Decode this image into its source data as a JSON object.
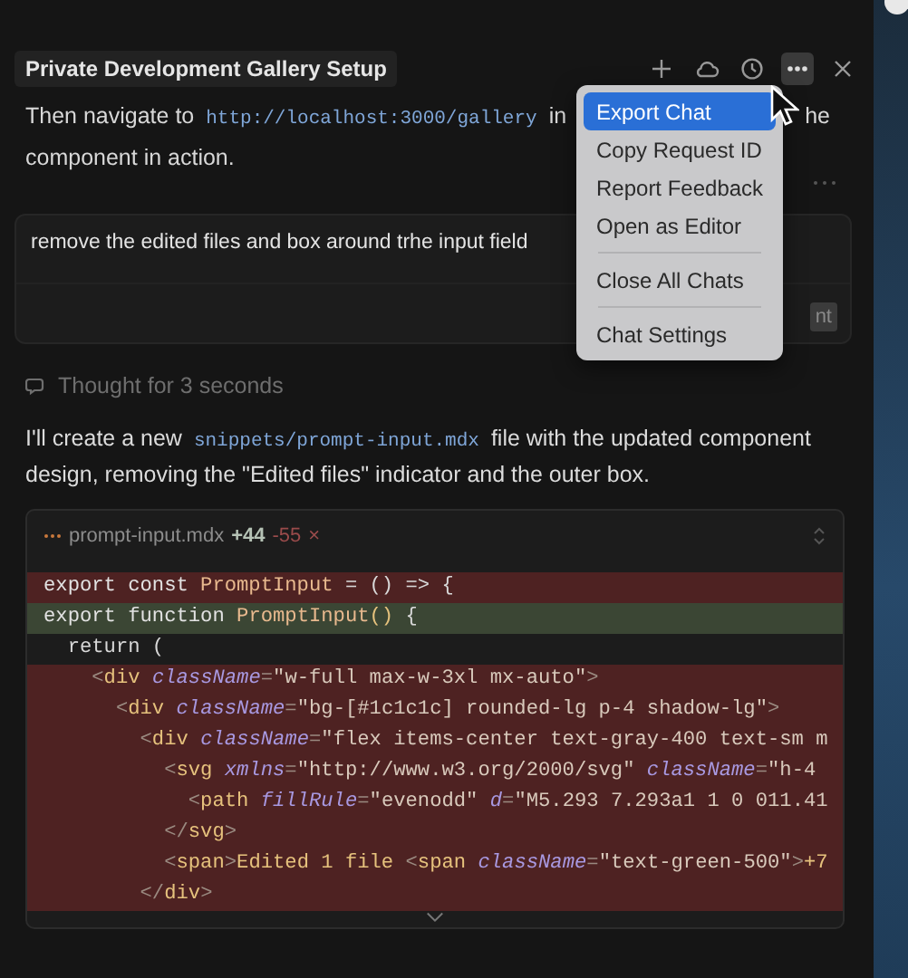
{
  "header": {
    "title": "Private Development Gallery Setup",
    "actions": [
      {
        "kind": "plus",
        "active": false
      },
      {
        "kind": "cloud",
        "active": false
      },
      {
        "kind": "history",
        "active": false
      },
      {
        "kind": "more",
        "active": true
      },
      {
        "kind": "close",
        "active": false
      }
    ]
  },
  "intro": {
    "line_1": [
      {
        "kind": "text",
        "text": "Then navigate to"
      },
      {
        "kind": "code",
        "text": "http://localhost:3000/gallery"
      },
      {
        "kind": "text",
        "text": "in"
      }
    ],
    "line_1_tail": "he",
    "line_2": "component in action."
  },
  "prompt": {
    "text": "remove the edited files and box around trhe input field",
    "button": "nt"
  },
  "thought": "Thought for 3 seconds",
  "reply": [
    {
      "kind": "text",
      "text": "I'll create a new "
    },
    {
      "kind": "code",
      "text": "snippets/prompt-input.mdx"
    },
    {
      "kind": "text",
      "text": " file with the updated component design, removing the \"Edited files\" indicator and the outer box."
    }
  ],
  "code_block": {
    "file": "prompt-input.mdx",
    "added": "+44",
    "removed": "-55",
    "close": "×",
    "lines": [
      {
        "kind": "removed",
        "tokens": [
          {
            "kind": "kw",
            "text": "export const "
          },
          {
            "kind": "name",
            "text": "PromptInput"
          },
          {
            "kind": "plain",
            "text": " = () => {"
          }
        ]
      },
      {
        "kind": "added",
        "tokens": [
          {
            "kind": "kw",
            "text": "export function "
          },
          {
            "kind": "name",
            "text": "PromptInput"
          },
          {
            "kind": "tag",
            "text": "()"
          },
          {
            "kind": "plain",
            "text": " {"
          }
        ]
      },
      {
        "kind": "context",
        "tokens": [
          {
            "kind": "plain",
            "text": "  return ("
          }
        ]
      },
      {
        "kind": "removed",
        "tokens": [
          {
            "kind": "punct",
            "text": "    <"
          },
          {
            "kind": "tag",
            "text": "div "
          },
          {
            "kind": "attr",
            "text": "className"
          },
          {
            "kind": "punct",
            "text": "="
          },
          {
            "kind": "str",
            "text": "\"w-full max-w-3xl mx-auto\""
          },
          {
            "kind": "punct",
            "text": ">"
          }
        ]
      },
      {
        "kind": "removed",
        "tokens": [
          {
            "kind": "punct",
            "text": "      <"
          },
          {
            "kind": "tag",
            "text": "div "
          },
          {
            "kind": "attr",
            "text": "className"
          },
          {
            "kind": "punct",
            "text": "="
          },
          {
            "kind": "str",
            "text": "\"bg-[#1c1c1c] rounded-lg p-4 shadow-lg\""
          },
          {
            "kind": "punct",
            "text": ">"
          }
        ]
      },
      {
        "kind": "removed",
        "tokens": [
          {
            "kind": "punct",
            "text": "        <"
          },
          {
            "kind": "tag",
            "text": "div "
          },
          {
            "kind": "attr",
            "text": "className"
          },
          {
            "kind": "punct",
            "text": "="
          },
          {
            "kind": "str",
            "text": "\"flex items-center text-gray-400 text-sm m"
          }
        ]
      },
      {
        "kind": "removed",
        "tokens": [
          {
            "kind": "punct",
            "text": "          <"
          },
          {
            "kind": "tag",
            "text": "svg "
          },
          {
            "kind": "attr",
            "text": "xmlns"
          },
          {
            "kind": "punct",
            "text": "="
          },
          {
            "kind": "str",
            "text": "\"http://www.w3.org/2000/svg\" "
          },
          {
            "kind": "attr",
            "text": "className"
          },
          {
            "kind": "punct",
            "text": "="
          },
          {
            "kind": "str",
            "text": "\"h-4"
          }
        ]
      },
      {
        "kind": "removed",
        "tokens": [
          {
            "kind": "punct",
            "text": "            <"
          },
          {
            "kind": "tag",
            "text": "path "
          },
          {
            "kind": "attr",
            "text": "fillRule"
          },
          {
            "kind": "punct",
            "text": "="
          },
          {
            "kind": "str",
            "text": "\"evenodd\" "
          },
          {
            "kind": "attr",
            "text": "d"
          },
          {
            "kind": "punct",
            "text": "="
          },
          {
            "kind": "str",
            "text": "\"M5.293 7.293a1 1 0 011.41"
          }
        ]
      },
      {
        "kind": "removed",
        "tokens": [
          {
            "kind": "punct",
            "text": "          </"
          },
          {
            "kind": "tag",
            "text": "svg"
          },
          {
            "kind": "punct",
            "text": ">"
          }
        ]
      },
      {
        "kind": "removed",
        "tokens": [
          {
            "kind": "punct",
            "text": "          <"
          },
          {
            "kind": "tag",
            "text": "span"
          },
          {
            "kind": "punct",
            "text": ">"
          },
          {
            "kind": "tag",
            "text": "Edited 1 file "
          },
          {
            "kind": "punct",
            "text": "<"
          },
          {
            "kind": "tag",
            "text": "span "
          },
          {
            "kind": "attr",
            "text": "className"
          },
          {
            "kind": "punct",
            "text": "="
          },
          {
            "kind": "str",
            "text": "\"text-green-500\""
          },
          {
            "kind": "punct",
            "text": ">"
          },
          {
            "kind": "tag",
            "text": "+7"
          }
        ]
      },
      {
        "kind": "removed",
        "tokens": [
          {
            "kind": "punct",
            "text": "        </"
          },
          {
            "kind": "tag",
            "text": "div"
          },
          {
            "kind": "punct",
            "text": ">"
          }
        ]
      }
    ]
  },
  "menu": {
    "groups": [
      [
        {
          "label": "Export Chat",
          "selected": true
        },
        {
          "label": "Copy Request ID",
          "selected": false
        },
        {
          "label": "Report Feedback",
          "selected": false
        },
        {
          "label": "Open as Editor",
          "selected": false
        }
      ],
      [
        {
          "label": "Close All Chats",
          "selected": false
        }
      ],
      [
        {
          "label": "Chat Settings",
          "selected": false
        }
      ]
    ]
  }
}
